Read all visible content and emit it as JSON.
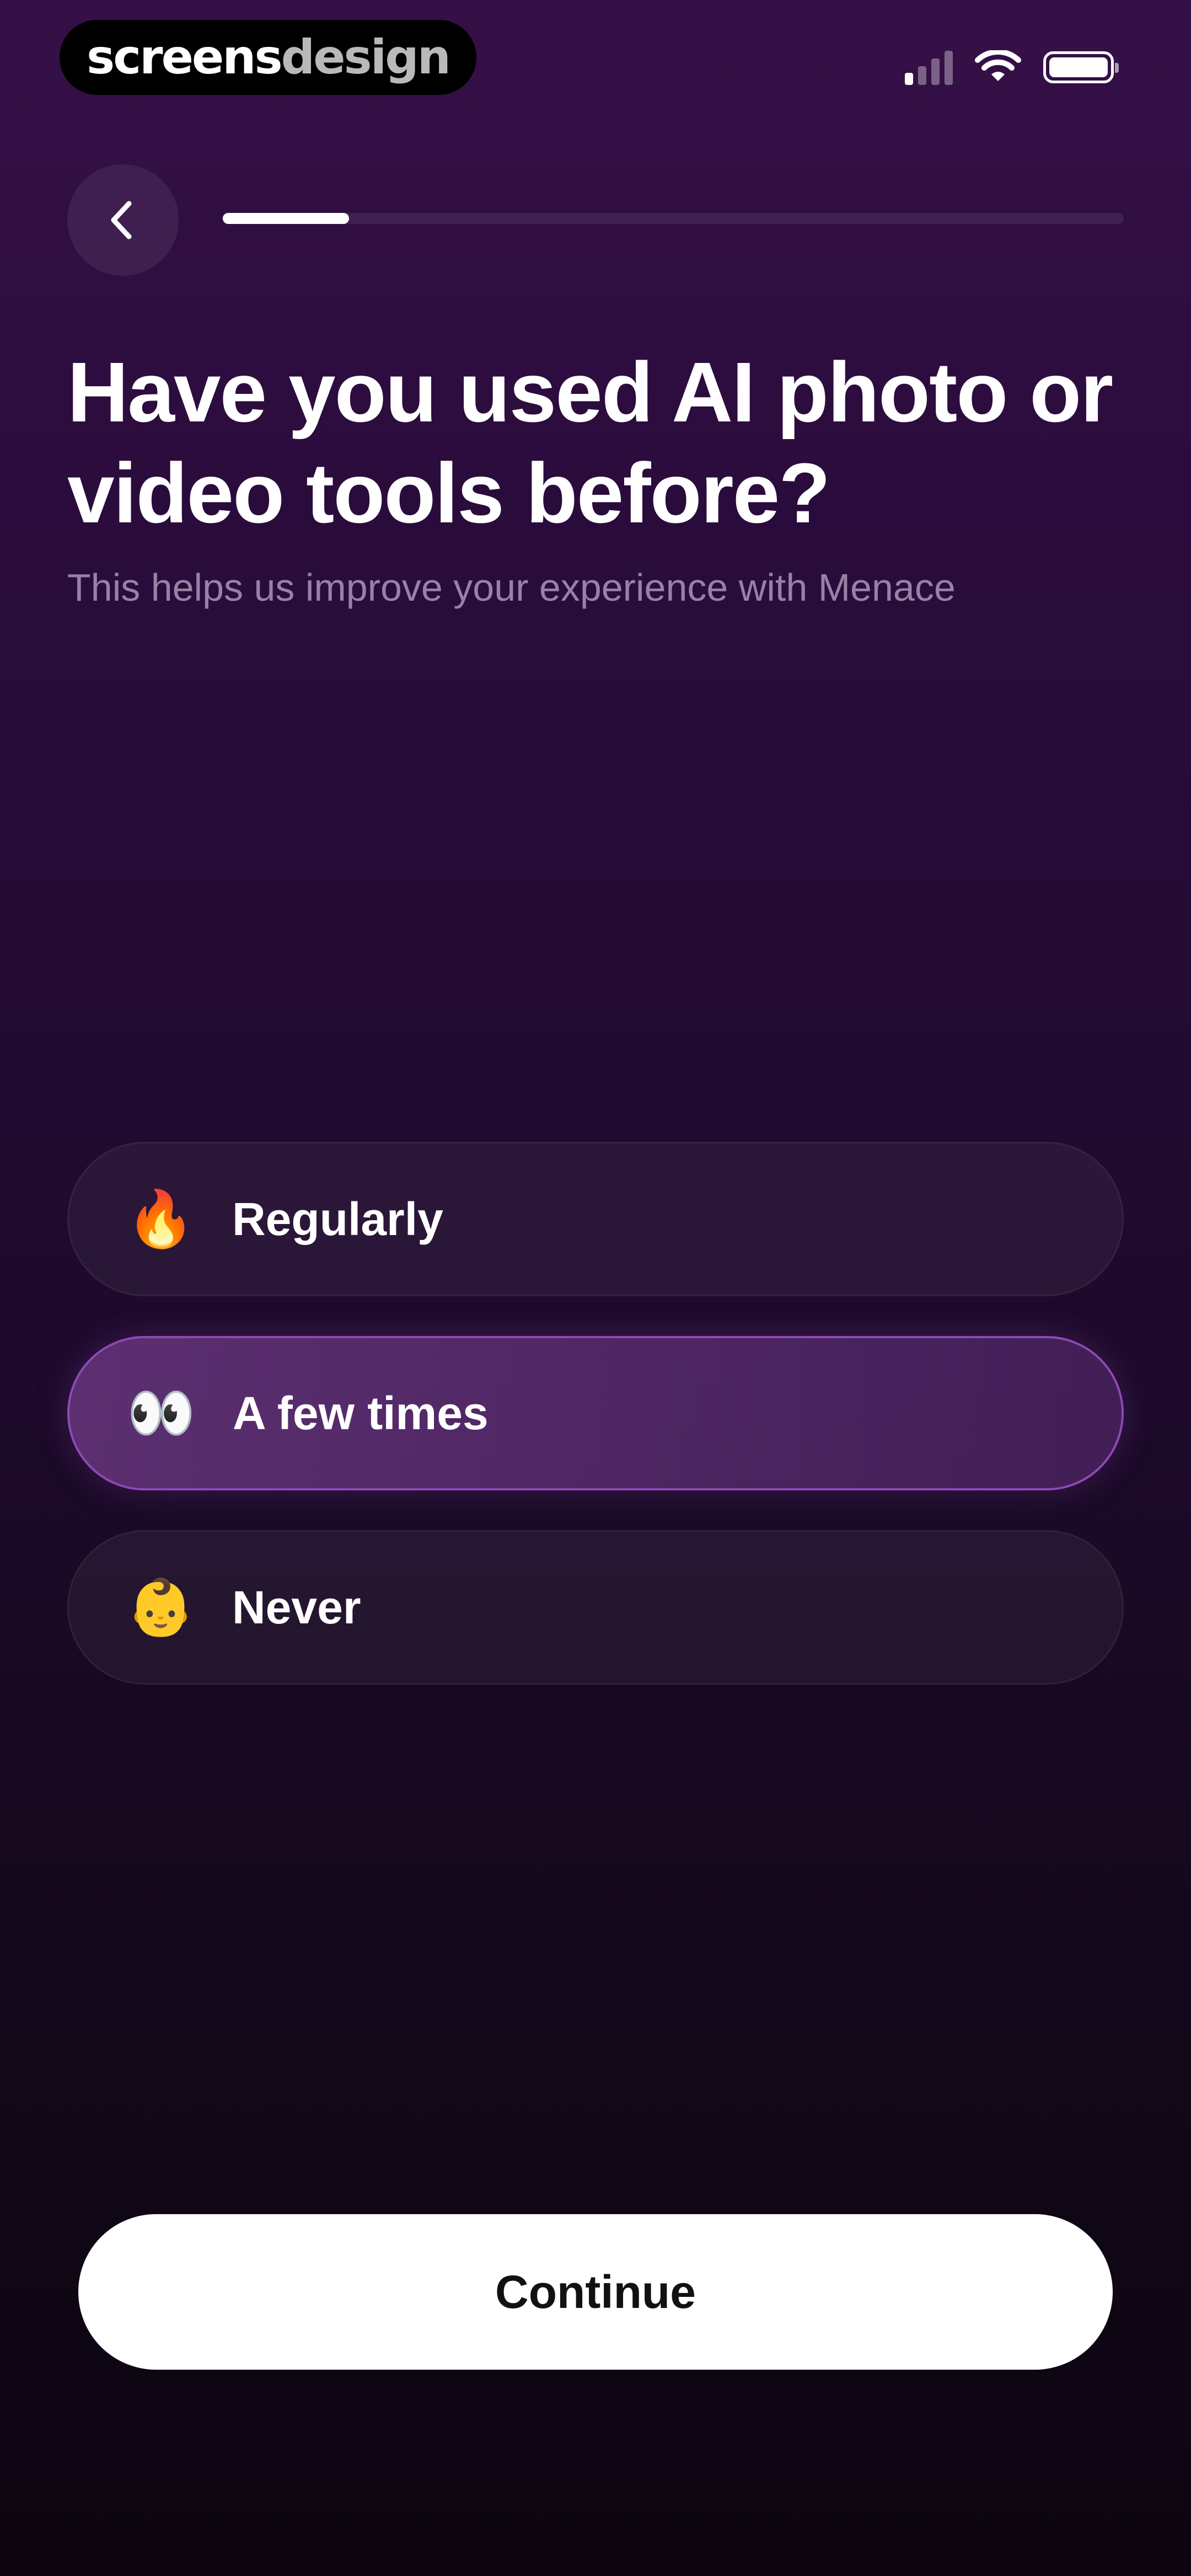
{
  "status_bar": {
    "brand_part1": "screens",
    "brand_part2": "design",
    "icons": [
      "cellular-signal-icon",
      "wifi-icon",
      "battery-icon"
    ],
    "signal_bars_active": 1,
    "signal_bars_total": 4
  },
  "nav": {
    "back_icon": "chevron-left-icon",
    "progress_fraction": 0.14
  },
  "question": {
    "title": "Have you used AI photo or video tools before?",
    "subtitle": "This helps us improve your experience with Menace"
  },
  "options": [
    {
      "emoji": "🔥",
      "icon": "fire-emoji-icon",
      "label": "Regularly",
      "selected": false
    },
    {
      "emoji": "👀",
      "icon": "eyes-emoji-icon",
      "label": "A few times",
      "selected": true
    },
    {
      "emoji": "👶",
      "icon": "baby-emoji-icon",
      "label": "Never",
      "selected": false
    }
  ],
  "continue_label": "Continue",
  "colors": {
    "background_top": "#351047",
    "background_bottom": "#0c0510",
    "accent": "#8c4ab4",
    "button_bg": "#ffffff",
    "button_text": "#111111"
  }
}
